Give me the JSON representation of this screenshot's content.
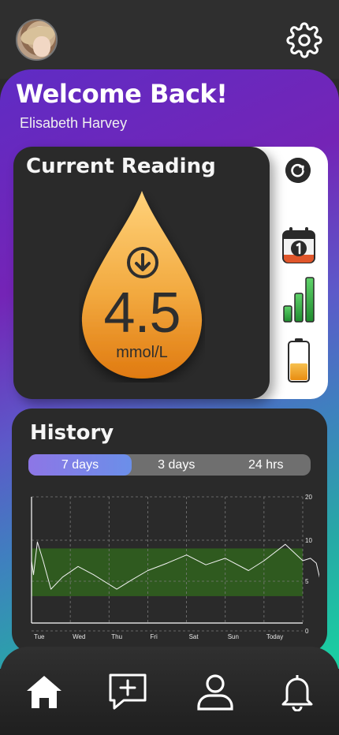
{
  "header": {
    "avatar_icon": "user-avatar",
    "settings_icon": "gear-icon"
  },
  "greeting": {
    "title": "Welcome Back!",
    "name": "Elisabeth Harvey"
  },
  "current_reading": {
    "title": "Current Reading",
    "value": "4.5",
    "unit": "mmol/L",
    "trend_icon": "arrow-down-icon",
    "drop_color": "#f0a63a",
    "side_icons": [
      "refresh-icon",
      "calendar-icon",
      "signal-bars-icon",
      "battery-icon"
    ],
    "battery_level": 0.45
  },
  "history": {
    "title": "History",
    "tabs": [
      "7 days",
      "3 days",
      "24 hrs"
    ],
    "active_tab": 0,
    "chart_data": {
      "type": "line",
      "x": [
        "Tue",
        "Wed",
        "Thu",
        "Fri",
        "Sat",
        "Sun",
        "Today"
      ],
      "y_ticks": [
        0,
        5,
        10,
        20
      ],
      "target_range": [
        3.5,
        9
      ],
      "target_color": "#2f5a1f",
      "line_color": "#f2f2f2",
      "series": [
        {
          "values": [
            [
              0.0,
              7.5
            ],
            [
              0.05,
              5.8
            ],
            [
              0.15,
              9.8
            ],
            [
              0.3,
              7.5
            ],
            [
              0.5,
              4.2
            ],
            [
              0.8,
              5.5
            ],
            [
              1.2,
              6.8
            ],
            [
              1.6,
              5.8
            ],
            [
              2.2,
              4.2
            ],
            [
              2.6,
              5.2
            ],
            [
              3.0,
              6.3
            ],
            [
              3.5,
              7.2
            ],
            [
              4.0,
              8.2
            ],
            [
              4.5,
              7.0
            ],
            [
              5.0,
              7.8
            ],
            [
              5.6,
              6.3
            ],
            [
              6.0,
              7.5
            ],
            [
              6.55,
              9.5
            ],
            [
              7.0,
              7.5
            ],
            [
              7.2,
              7.8
            ],
            [
              7.35,
              7.2
            ],
            [
              7.5,
              4.3
            ]
          ]
        }
      ],
      "ylim": [
        0,
        20
      ]
    }
  },
  "bottom_nav": {
    "items": [
      "home-icon",
      "add-note-icon",
      "profile-icon",
      "bell-icon"
    ],
    "active": 0
  }
}
